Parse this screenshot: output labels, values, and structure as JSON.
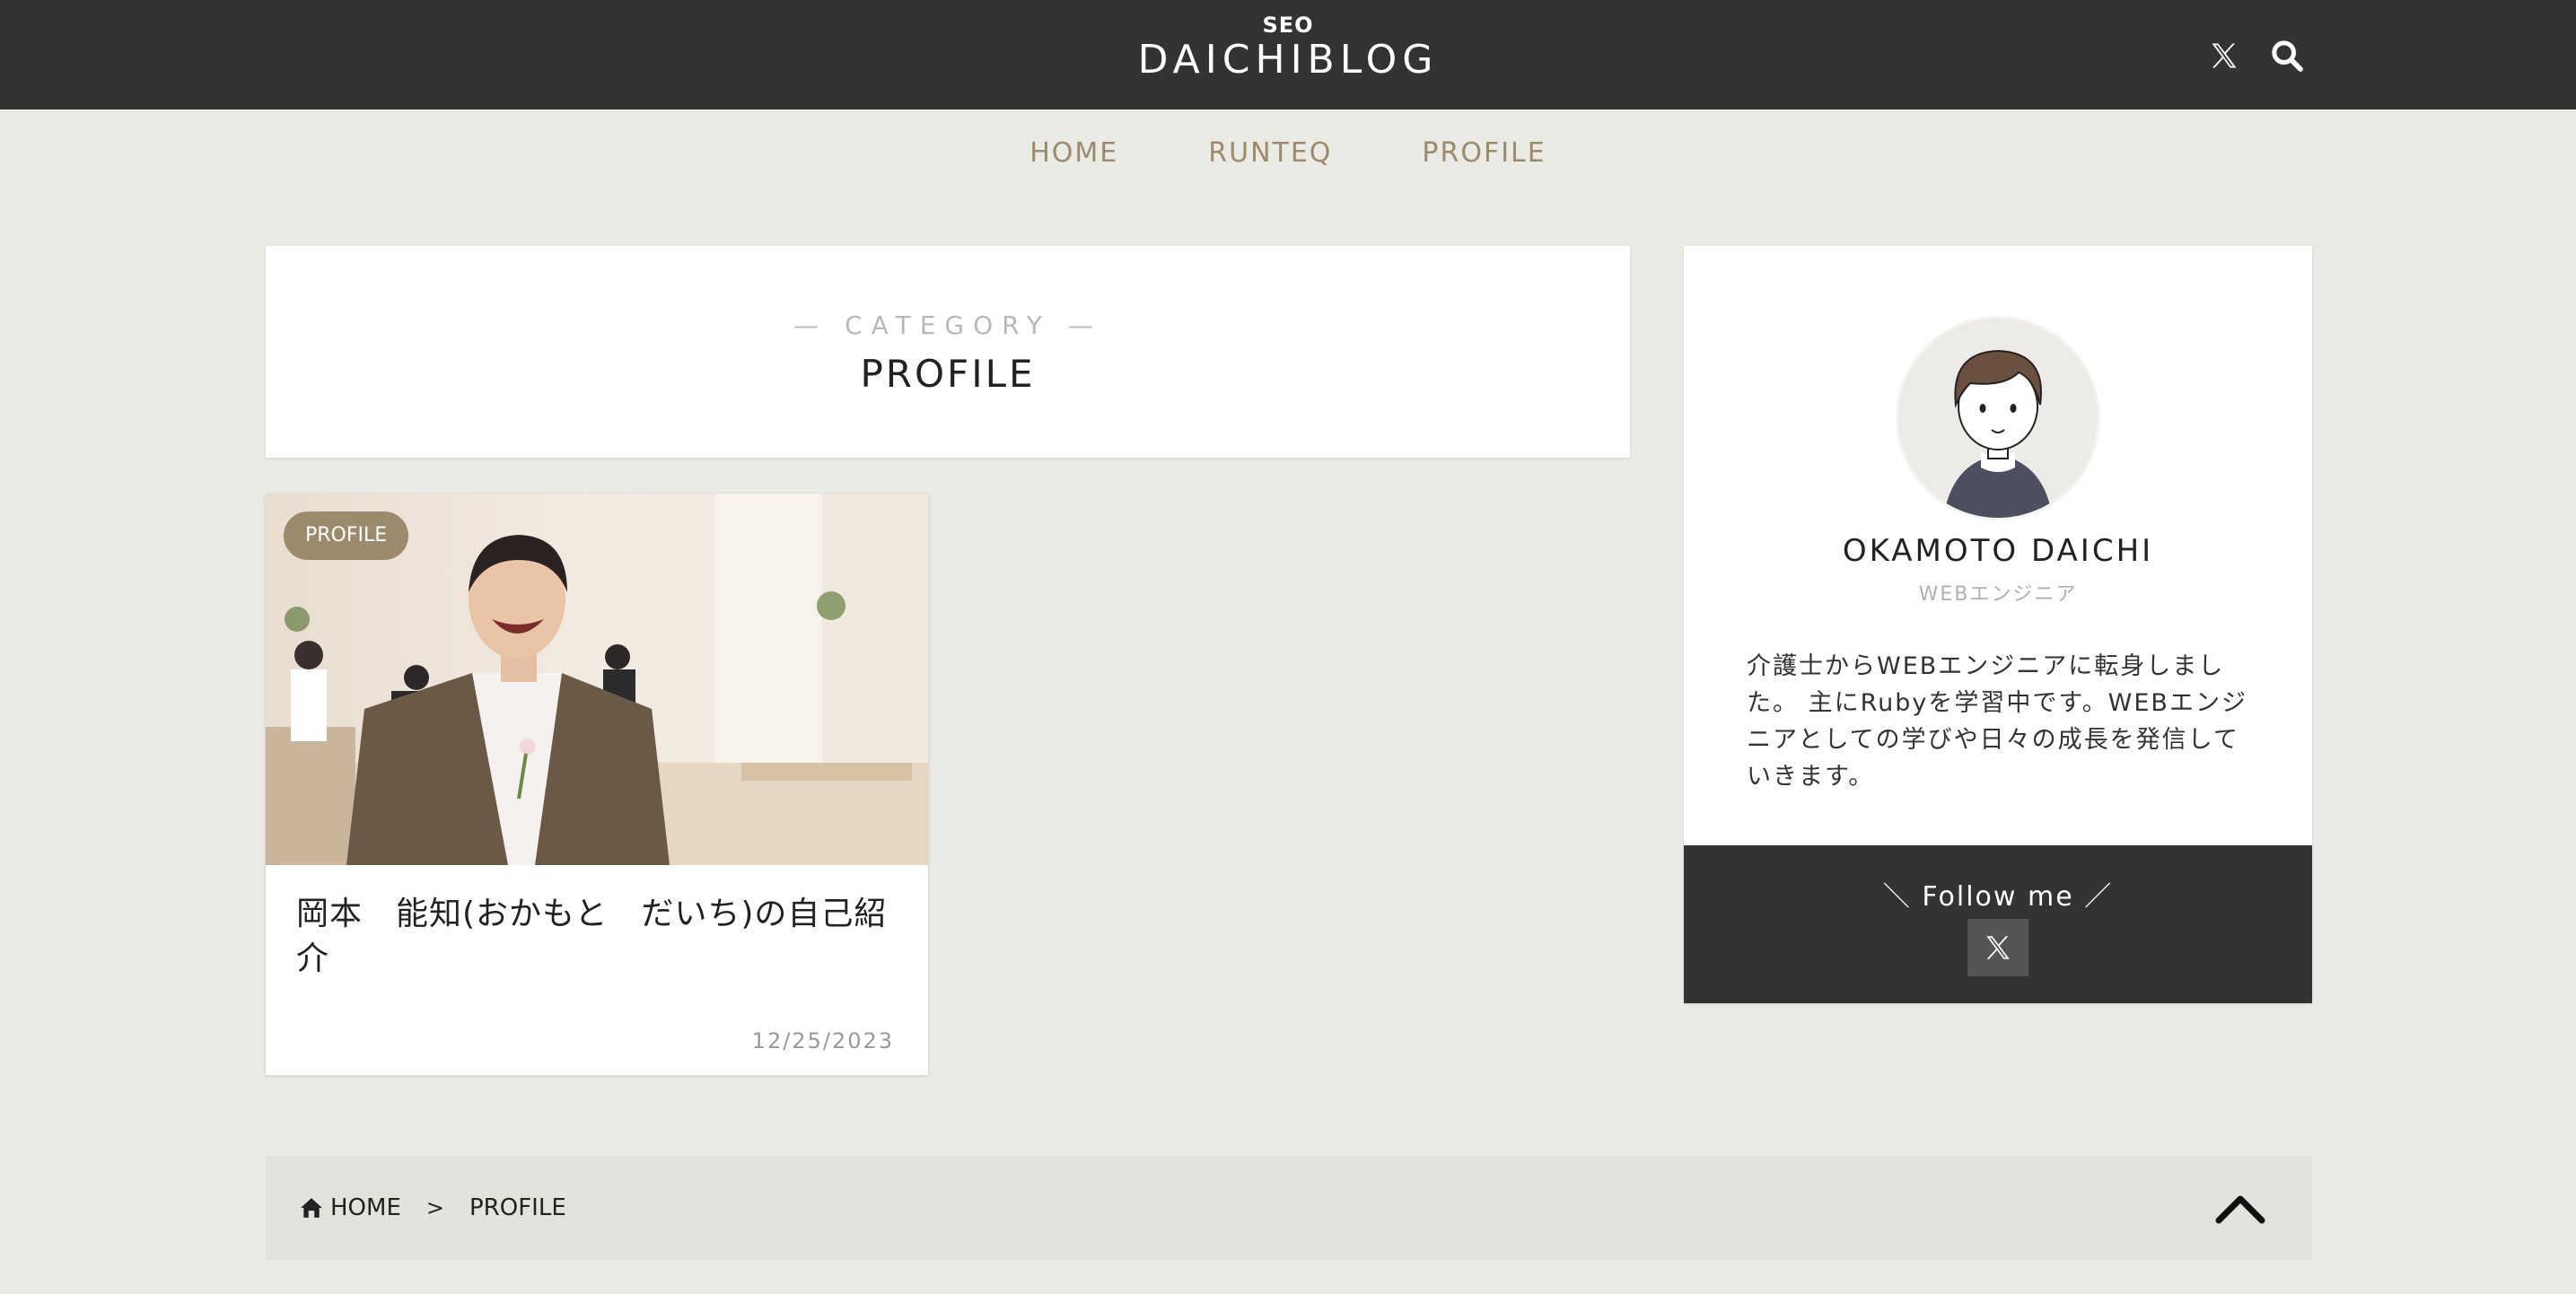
{
  "header": {
    "logo_top": "SEO",
    "logo_main": "DAICHIBLOG",
    "icons": [
      "x-logo-icon",
      "search-icon"
    ]
  },
  "nav": {
    "items": [
      {
        "label": "HOME"
      },
      {
        "label": "RUNTEQ"
      },
      {
        "label": "PROFILE"
      }
    ]
  },
  "category": {
    "label": "— CATEGORY —",
    "title": "PROFILE"
  },
  "post": {
    "badge": "PROFILE",
    "title": "岡本　能知(おかもと　だいち)の自己紹介",
    "date": "12/25/2023"
  },
  "profile": {
    "name": "OKAMOTO DAICHI",
    "role": "WEBエンジニア",
    "bio": "介護士からWEBエンジニアに転身しました。 主にRubyを学習中です。WEBエンジニアとしての学びや日々の成長を発信していきます。",
    "follow_label": "＼ Follow me ／"
  },
  "breadcrumb": {
    "home": "HOME",
    "separator": ">",
    "current": "PROFILE"
  },
  "colors": {
    "header_bg": "#333333",
    "accent": "#9c8a6c",
    "page_bg": "#ebebe6"
  }
}
